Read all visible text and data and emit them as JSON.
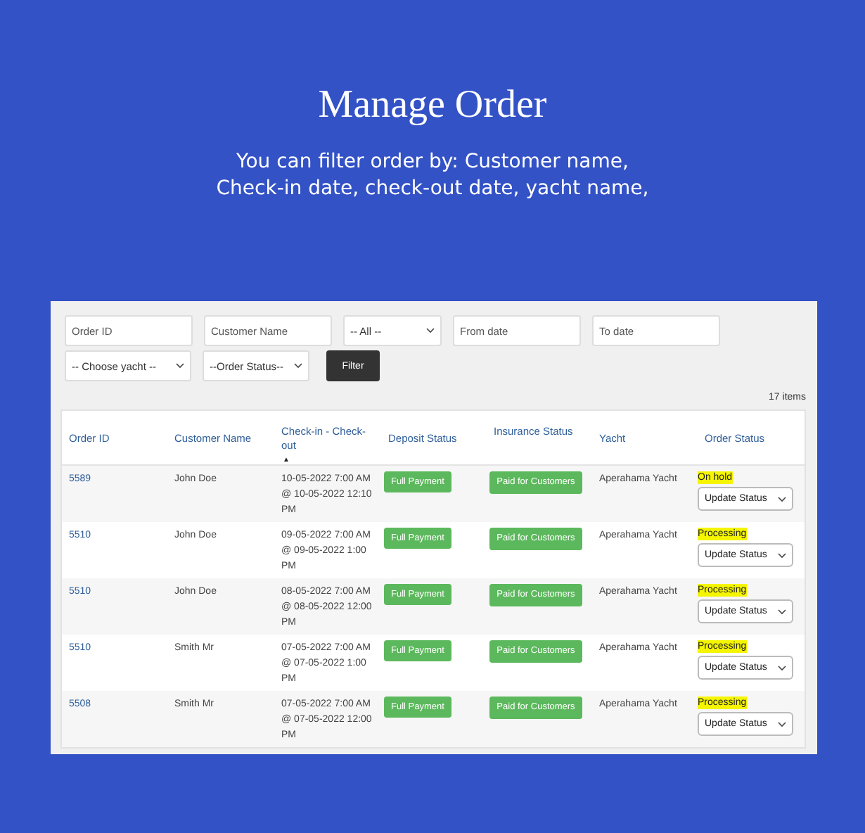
{
  "heading": {
    "title": "Manage Order",
    "subtitle_lines": [
      "You can filter order by: Customer name,",
      "Check-in date, check-out date, yacht name,"
    ]
  },
  "filters": [
    {
      "kind": "field",
      "placeholder": "Order ID"
    },
    {
      "kind": "field",
      "placeholder": "Customer Name"
    },
    {
      "kind": "select",
      "value": "-- All --"
    },
    {
      "kind": "field",
      "placeholder": "From date"
    },
    {
      "kind": "field",
      "placeholder": "To date"
    },
    {
      "kind": "select",
      "value": "-- Choose yacht --"
    },
    {
      "kind": "select",
      "value": "--Order Status--"
    },
    {
      "kind": "button",
      "label": "Filter"
    }
  ],
  "item_count": "17 items",
  "table": {
    "columns": [
      {
        "label": "Order ID"
      },
      {
        "label": "Customer Name"
      },
      {
        "label": "Check-in - Check-out",
        "sort_indicator": "▲"
      },
      {
        "label": "Deposit Status"
      },
      {
        "label": "Insurance Status"
      },
      {
        "label": "Yacht"
      },
      {
        "label": "Order Status"
      }
    ],
    "rows": [
      {
        "order_id": "5589",
        "customer": "John Doe",
        "dates": "10-05-2022 7:00 AM @ 10-05-2022 12:10 PM",
        "deposit": "Full Payment",
        "insurance": "Paid for Customers",
        "yacht": "Aperahama Yacht",
        "status": "On hold",
        "action": "Update Status"
      },
      {
        "order_id": "5510",
        "customer": "John Doe",
        "dates": "09-05-2022 7:00 AM @ 09-05-2022 1:00 PM",
        "deposit": "Full Payment",
        "insurance": "Paid for Customers",
        "yacht": "Aperahama Yacht",
        "status": "Processing",
        "action": "Update Status"
      },
      {
        "order_id": "5510",
        "customer": "John Doe",
        "dates": "08-05-2022 7:00 AM @ 08-05-2022 12:00 PM",
        "deposit": "Full Payment",
        "insurance": "Paid for Customers",
        "yacht": "Aperahama Yacht",
        "status": "Processing",
        "action": "Update Status"
      },
      {
        "order_id": "5510",
        "customer": "Smith Mr",
        "dates": "07-05-2022 7:00 AM @ 07-05-2022 1:00 PM",
        "deposit": "Full Payment",
        "insurance": "Paid for Customers",
        "yacht": "Aperahama Yacht",
        "status": "Processing",
        "action": "Update Status"
      },
      {
        "order_id": "5508",
        "customer": "Smith Mr",
        "dates": "07-05-2022 7:00 AM @ 07-05-2022 12:00 PM",
        "deposit": "Full Payment",
        "insurance": "Paid for Customers",
        "yacht": "Aperahama Yacht",
        "status": "Processing",
        "action": "Update Status"
      }
    ]
  }
}
